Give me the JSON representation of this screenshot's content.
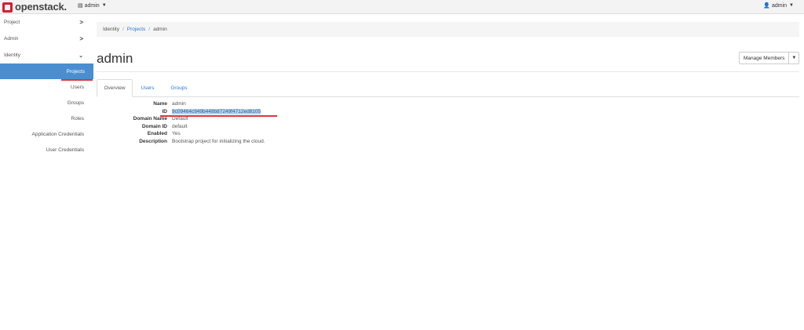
{
  "topbar": {
    "brand": "openstack.",
    "project": "admin",
    "user": "admin"
  },
  "sidebar": {
    "items": [
      {
        "label": "Project",
        "chevron": ">"
      },
      {
        "label": "Admin",
        "chevron": ">"
      },
      {
        "label": "Identity",
        "chevron": "v"
      }
    ],
    "identity_items": [
      {
        "label": "Projects",
        "active": true
      },
      {
        "label": "Users"
      },
      {
        "label": "Groups"
      },
      {
        "label": "Roles"
      },
      {
        "label": "Application Credentials"
      },
      {
        "label": "User Credentials"
      }
    ]
  },
  "breadcrumb": {
    "items": [
      "Identity",
      "Projects",
      "admin"
    ],
    "separator": "/"
  },
  "page": {
    "title": "admin",
    "manage_members_label": "Manage Members"
  },
  "tabs": [
    {
      "label": "Overview",
      "active": true
    },
    {
      "label": "Users"
    },
    {
      "label": "Groups"
    }
  ],
  "details": [
    {
      "label": "Name",
      "value": "admin"
    },
    {
      "label": "ID",
      "value": "9c09464c949b448b87249f4712ed8105"
    },
    {
      "label": "Domain Name",
      "value": "Default"
    },
    {
      "label": "Domain ID",
      "value": "default"
    },
    {
      "label": "Enabled",
      "value": "Yes"
    },
    {
      "label": "Description",
      "value": "Bootstrap project for initializing the cloud."
    }
  ],
  "colors": {
    "accent": "#4a8ed1",
    "link": "#2a7ac9",
    "brand_red": "#da1a32",
    "annotation_red": "#e0353f",
    "selection": "#b3d4f5"
  }
}
